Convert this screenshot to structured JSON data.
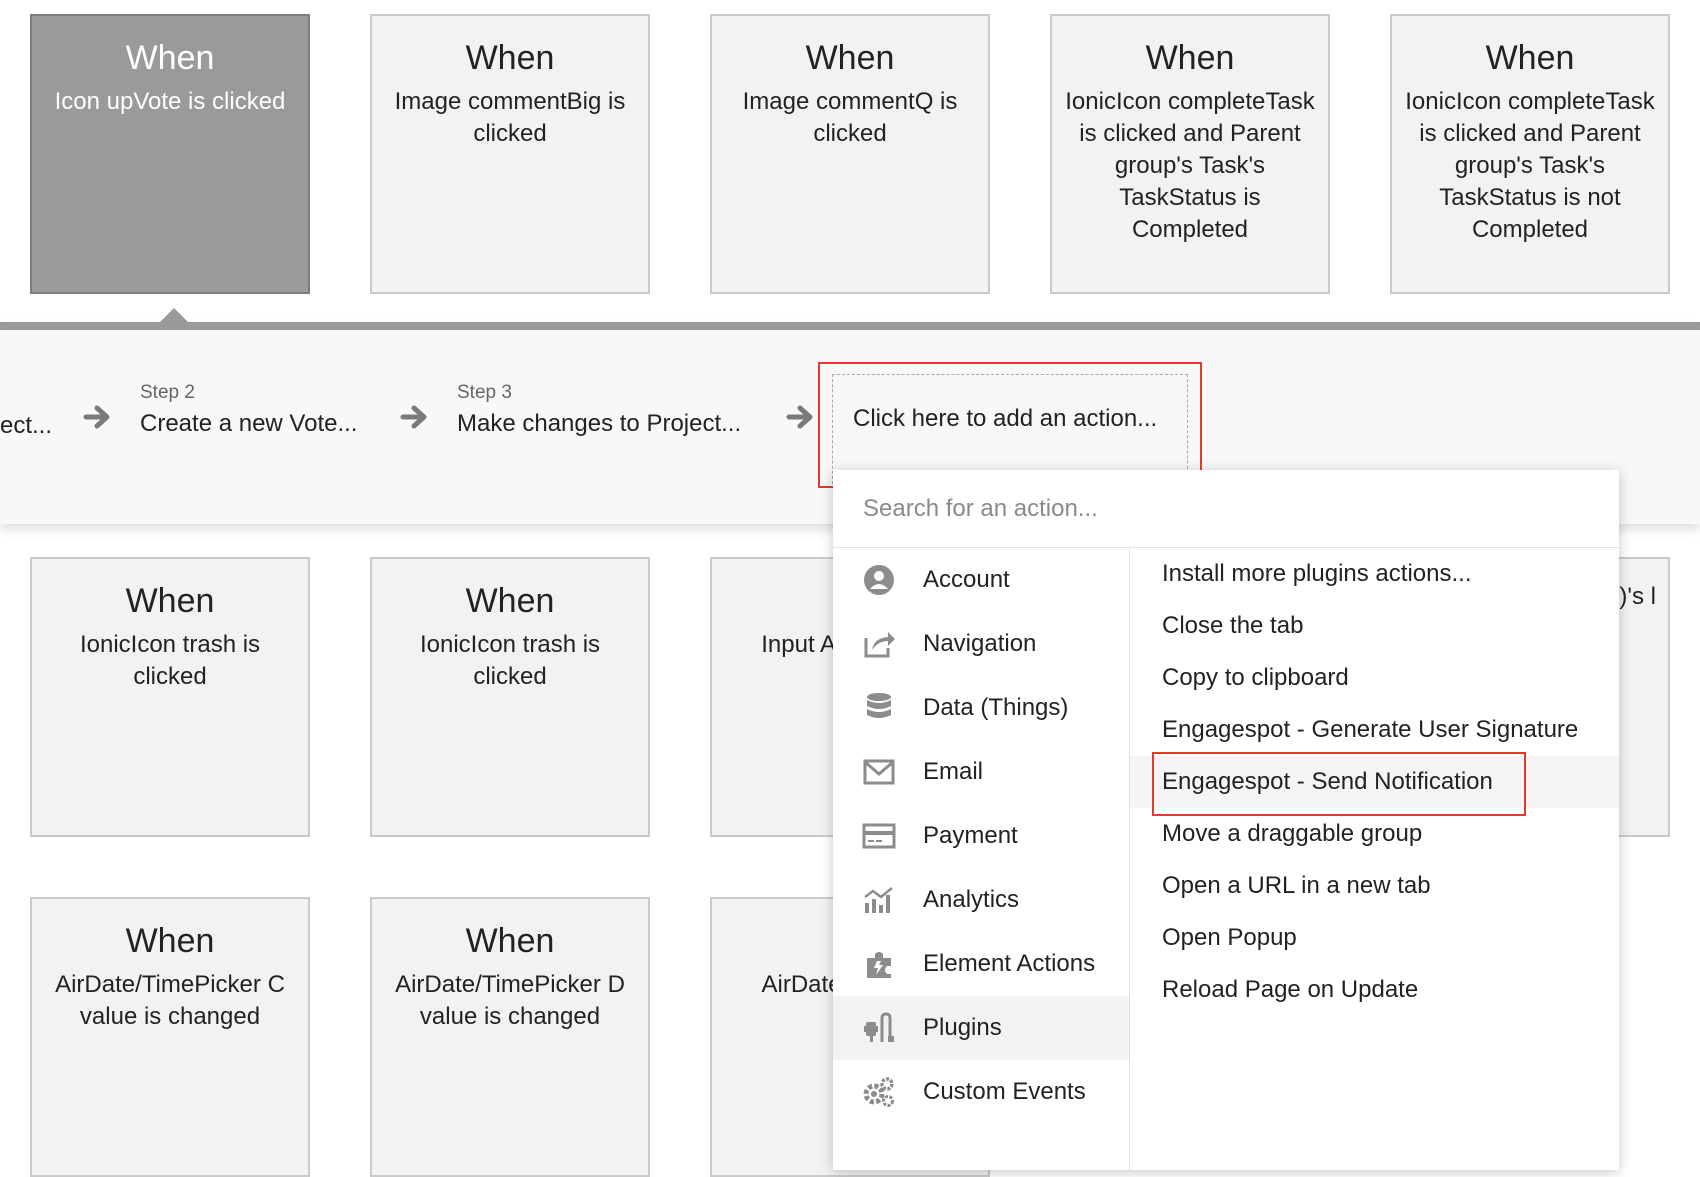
{
  "events_row1": [
    {
      "when": "When",
      "desc": "Icon upVote is clicked"
    },
    {
      "when": "When",
      "desc": "Image commentBig is clicked"
    },
    {
      "when": "When",
      "desc": "Image commentQ is clicked"
    },
    {
      "when": "When",
      "desc": "IonicIcon completeTask is clicked and Parent group's Task's TaskStatus is Completed"
    },
    {
      "when": "When",
      "desc": "IonicIcon completeTask is clicked and Parent group's Task's TaskStatus is not Completed"
    }
  ],
  "events_row2": [
    {
      "when": "When",
      "desc": "IonicIcon trash is clicked"
    },
    {
      "when": "When",
      "desc": "IonicIcon trash is clicked"
    },
    {
      "when": "W",
      "desc": "Input Add value i"
    },
    {
      "when": "",
      "desc": ")'s l"
    }
  ],
  "events_row3": [
    {
      "when": "When",
      "desc": "AirDate/TimePicker C value is changed"
    },
    {
      "when": "When",
      "desc": "AirDate/TimePicker D value is changed"
    },
    {
      "when": "W",
      "desc": "AirDate/T value i"
    }
  ],
  "workflow": {
    "steps": [
      {
        "label": "",
        "title": "ect..."
      },
      {
        "label": "Step 2",
        "title": "Create a new Vote..."
      },
      {
        "label": "Step 3",
        "title": "Make changes to Project..."
      }
    ],
    "add_action": "Click here to add an action..."
  },
  "dropdown": {
    "search_placeholder": "Search for an action...",
    "categories": [
      {
        "label": "Account",
        "icon": "account-icon"
      },
      {
        "label": "Navigation",
        "icon": "navigation-icon"
      },
      {
        "label": "Data (Things)",
        "icon": "database-icon"
      },
      {
        "label": "Email",
        "icon": "email-icon"
      },
      {
        "label": "Payment",
        "icon": "payment-icon"
      },
      {
        "label": "Analytics",
        "icon": "analytics-icon"
      },
      {
        "label": "Element Actions",
        "icon": "element-actions-icon"
      },
      {
        "label": "Plugins",
        "icon": "plugins-icon"
      },
      {
        "label": "Custom Events",
        "icon": "custom-events-icon"
      }
    ],
    "active_category": "Plugins",
    "actions": [
      "Install more plugins actions...",
      "Close the tab",
      "Copy to clipboard",
      "Engagespot - Generate User Signature",
      "Engagespot - Send Notification",
      "Move a draggable group",
      "Open a URL in a new tab",
      "Open Popup",
      "Reload Page on Update"
    ],
    "highlighted_action": "Engagespot - Send Notification"
  },
  "colors": {
    "highlight": "#e53a2b",
    "selected_card": "#9a9a9a",
    "card_bg": "#f1f2f1",
    "icon_gray": "#8c8c8c"
  }
}
